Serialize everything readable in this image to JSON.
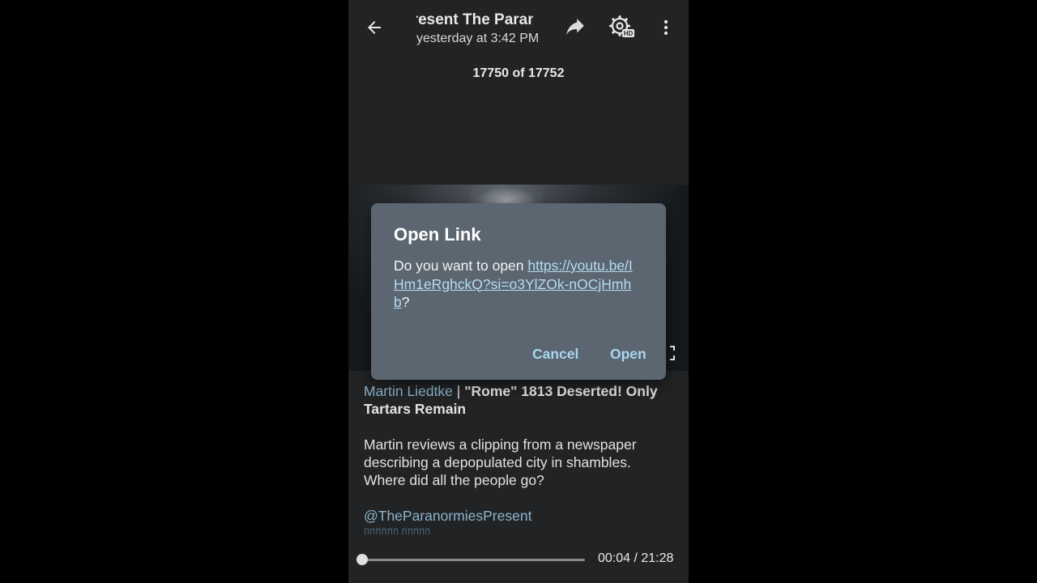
{
  "header": {
    "title": "Present   The Paranormies",
    "subtitle": "yesterday at 3:42 PM",
    "counter": "17750 of 17752",
    "icons": [
      "back-arrow-icon",
      "share-icon",
      "settings-hd-icon",
      "more-vert-icon"
    ]
  },
  "caption": {
    "author": "Martin Liedtke",
    "separator": " | ",
    "headline": "\"Rome\" 1813 Deserted! Only Tartars Remain",
    "description": "Martin reviews a clipping from a newspaper describing a depopulated city in shambles. Where did all the people go?",
    "handle": "@TheParanormiesPresent"
  },
  "player": {
    "time": "00:04 / 21:28",
    "progress_fraction": 0.003
  },
  "dialog": {
    "title": "Open Link",
    "prompt": "Do you want to open ",
    "url": "https://youtu.be/IHm1eRghckQ?si=o3YlZOk-nOCjHmhb",
    "suffix": "?",
    "cancel_label": "Cancel",
    "open_label": "Open"
  },
  "colors": {
    "background": "#222324",
    "dialog": "#5b6670",
    "accent": "#a9d6ef",
    "link": "#8ab4cf"
  }
}
